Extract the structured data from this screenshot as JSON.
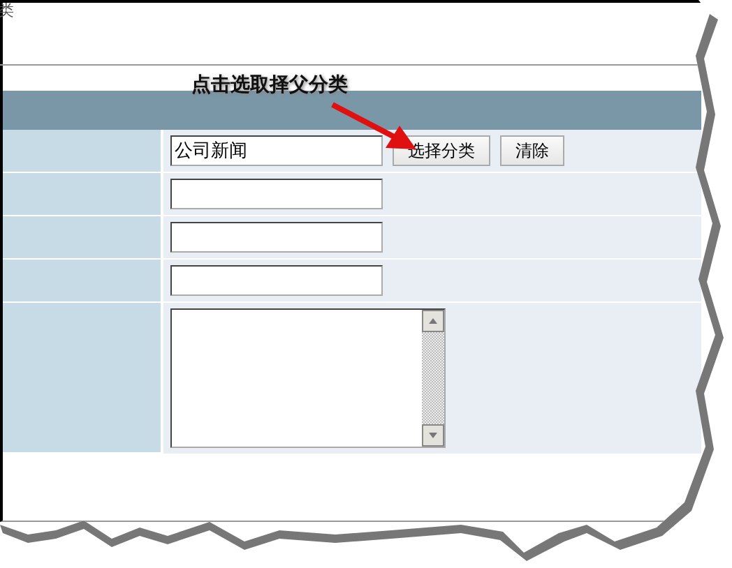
{
  "window": {
    "title": "类"
  },
  "annotation": {
    "text": "点击选取择父分类"
  },
  "form": {
    "rows": [
      {
        "kind": "text",
        "value": "公司新闻",
        "buttons": [
          "选择分类",
          "清除"
        ]
      },
      {
        "kind": "text"
      },
      {
        "kind": "text"
      },
      {
        "kind": "text"
      },
      {
        "kind": "textarea"
      }
    ]
  }
}
